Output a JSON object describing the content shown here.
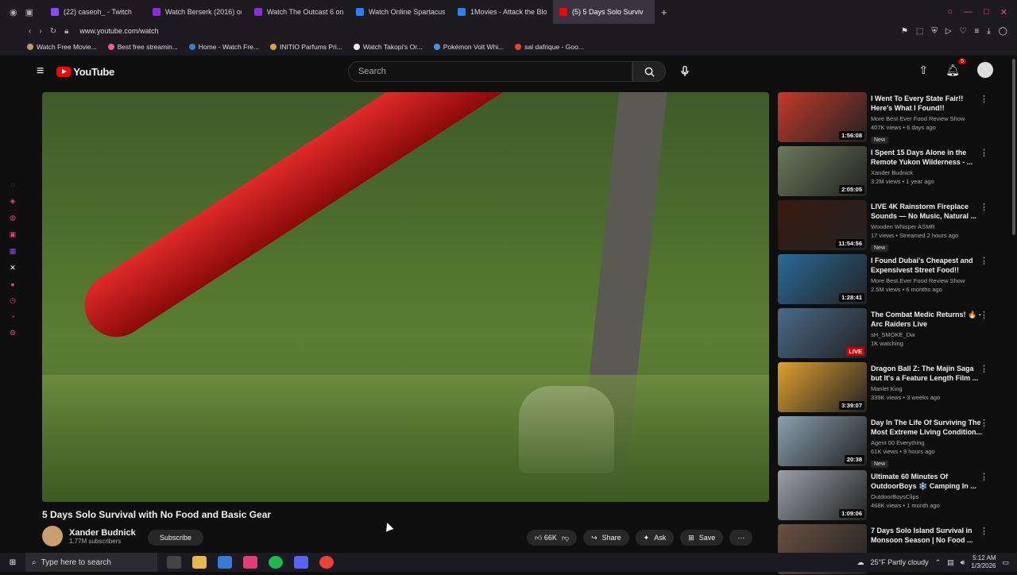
{
  "browser": {
    "tabs": [
      {
        "label": "(22) caseoh_ - Twitch",
        "color": "#9146ff"
      },
      {
        "label": "Watch Berserk (2016) onli",
        "color": "#8a2be2"
      },
      {
        "label": "Watch The Outcast 6 onli",
        "color": "#8a2be2"
      },
      {
        "label": "Watch Online Spartacus: ",
        "color": "#2a7fff"
      },
      {
        "label": "1Movies - Attack the Block",
        "color": "#2a7fff"
      },
      {
        "label": "(5) 5 Days Solo Surviv",
        "color": "#ff0000",
        "active": true
      }
    ],
    "new_tab": "+",
    "url": "www.youtube.com/watch",
    "bookmarks": [
      {
        "label": "Watch Free Movie...",
        "color": "#c19a6b"
      },
      {
        "label": "Best free streamin...",
        "color": "#e85d9a"
      },
      {
        "label": "Home - Watch Fre...",
        "color": "#3a7bd5"
      },
      {
        "label": "INITIO Parfums Pri...",
        "color": "#d4a44a"
      },
      {
        "label": "Watch Takopi's Or...",
        "color": "#f0f0f0"
      },
      {
        "label": "Pokémon Volt Whi...",
        "color": "#4a90e2"
      },
      {
        "label": "sal dafrique - Goo...",
        "color": "#ea4335"
      }
    ]
  },
  "youtube": {
    "logo": "YouTube",
    "search_placeholder": "Search",
    "notification_count": "5"
  },
  "video": {
    "title": "5 Days Solo Survival with No Food and Basic Gear",
    "channel": "Xander Budnick",
    "subscribers": "1.77M subscribers",
    "subscribe_label": "Subscribe",
    "likes": "66K",
    "share_label": "Share",
    "ask_label": "Ask",
    "save_label": "Save"
  },
  "recommendations": [
    {
      "title": "I Went To Every State Fair!! Here's What I Found!!",
      "channel": "More Best Ever Food Review Show",
      "views": "407K views • 6 days ago",
      "badge": "New",
      "duration": "1:56:08",
      "thumb": "#c23a2a"
    },
    {
      "title": "I Spent 15 Days Alone in the Remote Yukon Wilderness - ...",
      "channel": "Xander Budnick",
      "views": "3.2M views • 1 year ago",
      "badge": "",
      "duration": "2:05:05",
      "thumb": "#6b7a5a"
    },
    {
      "title": "LIVE 4K Rainstorm Fireplace Sounds — No Music, Natural ...",
      "channel": "Wooden Whisper ASMR",
      "views": "17 views • Streamed 2 hours ago",
      "badge": "New",
      "duration": "11:54:56",
      "thumb": "#3a1a10"
    },
    {
      "title": "I Found Dubai's Cheapest and Expensivest Street Food!!",
      "channel": "More Best Ever Food Review Show",
      "views": "2.5M views • 6 months ago",
      "badge": "",
      "duration": "1:28:41",
      "thumb": "#2a6a9a"
    },
    {
      "title": "The Combat Medic Returns! 🔥 - Arc Raiders Live",
      "channel": "sH_SMOKE_Dw",
      "views": "1K watching",
      "badge": "",
      "duration": "LIVE",
      "thumb": "#4a6a8a"
    },
    {
      "title": "Dragon Ball Z: The Majin Saga but It's a Feature Length Film ...",
      "channel": "Manlet King",
      "views": "339K views • 3 weeks ago",
      "badge": "",
      "duration": "3:39:07",
      "thumb": "#e0a030"
    },
    {
      "title": "Day In The Life Of Surviving The Most Extreme Living Condition...",
      "channel": "Agent 00 Everything",
      "views": "61K views • 9 hours ago",
      "badge": "New",
      "duration": "20:38",
      "thumb": "#8aa0b0"
    },
    {
      "title": "Ultimate 60 Minutes Of OutdoorBoys ❄️ Camping In ...",
      "channel": "OutdoorBoysClips",
      "views": "468K views • 1 month ago",
      "badge": "",
      "duration": "1:09:06",
      "thumb": "#9aa0a8"
    },
    {
      "title": "7 Days Solo Island Survival in Monsoon Season | No Food ...",
      "channel": "",
      "views": "",
      "badge": "",
      "duration": "",
      "thumb": "#6a5040"
    }
  ],
  "taskbar": {
    "search_placeholder": "Type here to search",
    "weather": "25°F  Partly cloudy",
    "time": "5:12 AM",
    "date": "1/3/2026"
  }
}
